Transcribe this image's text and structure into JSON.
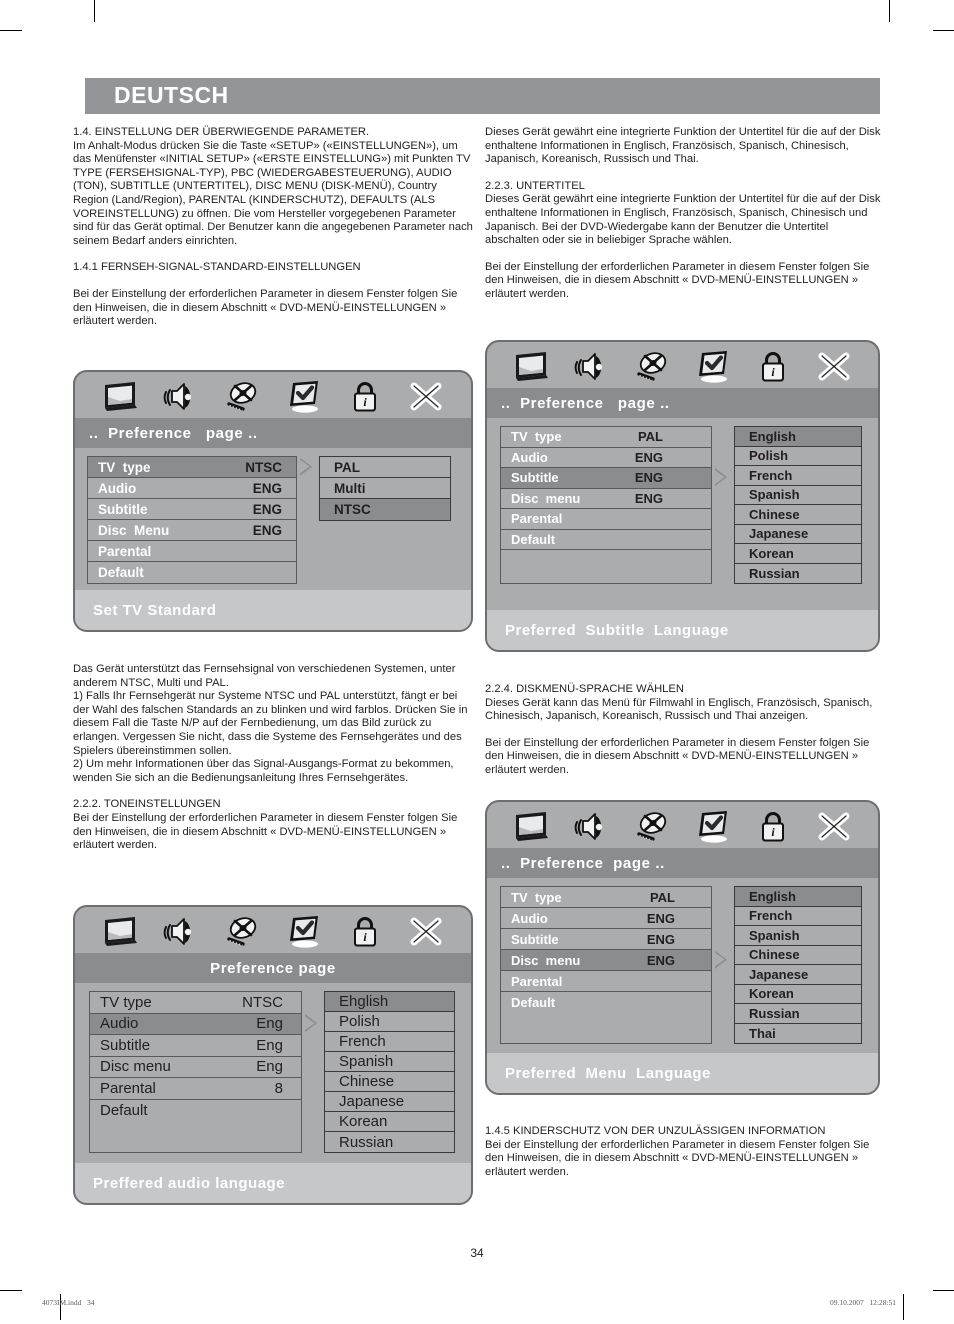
{
  "page": {
    "language_header": "DEUTSCH",
    "page_number": "34",
    "printer_file": "4073IM.indd   34",
    "printer_timestamp": "09.10.2007   12:28:51"
  },
  "colors": {
    "header_band": "#939598",
    "osd_background": "#aaacae",
    "osd_titlebar": "#8a8c8e",
    "osd_highlight": "#8a8c8e",
    "osd_status_strip": "#c6c7c9",
    "osd_border": "#6d6e71",
    "text": "#231f20"
  },
  "left_column": {
    "section_1_4_heading": "1.4. EINSTELLUNG DER ÜBERWIEGENDE PARAMETER.",
    "section_1_4_body": "Im Anhalt-Modus drücken Sie die Taste «SETUP» («EINSTELLUNGEN»), um das Menüfenster «INITIAL SETUP» («ERSTE EINSTELLUNG») mit Punkten TV TYPE (FERSEHSIGNAL-TYP), PBC (WIEDERGABESTEUERUNG), AUDIO (TON), SUBTITLLE (UNTERTITEL), DISC MENU (DISK-MENÜ), Country Region (Land/Region), PARENTAL (KINDERSCHUTZ), DEFAULTS (ALS VOREINSTELLUNG) zu öffnen. Die vom Hersteller vorgegebenen Parameter sind für das Gerät optimal. Der Benutzer kann die angegebenen Parameter nach seinem Bedarf anders einrichten.",
    "section_1_4_1_heading": "1.4.1 FERNSEH-SIGNAL-STANDARD-EINSTELLUNGEN",
    "section_1_4_1_body": "Bei der Einstellung der erforderlichen Parameter in diesem Fenster folgen Sie den Hinweisen, die in diesem Abschnitt « DVD-MENÜ-EINSTELLUNGEN » erläutert werden.",
    "after_screenshot_1_p1": "Das Gerät unterstützt das Fernsehsignal von verschiedenen Systemen, unter anderem NTSC, Multi und PAL.",
    "after_screenshot_1_p2": "1)              Falls Ihr Fernsehgerät nur Systeme NTSC und PAL unterstützt,  fängt er bei der Wahl des falschen Standards an zu blinken und wird farblos.  Drücken Sie in diesem Fall die Taste N/P auf der Fernbedienung, um das Bild zurück zu erlangen. Vergessen Sie nicht, dass die Systeme des Fernsehgerätes und des Spielers übereinstimmen sollen.",
    "after_screenshot_1_p3": "2)              Um mehr Informationen über das Signal-Ausgangs-Format zu bekommen, wenden Sie sich an die Bedienungsanleitung Ihres Fernsehgerätes.",
    "section_2_2_2_heading": "2.2.2.       TONEINSTELLUNGEN",
    "section_2_2_2_body": "Bei der Einstellung der erforderlichen Parameter in diesem Fenster folgen Sie den Hinweisen, die in diesem Abschnitt « DVD-MENÜ-EINSTELLUNGEN » erläutert werden."
  },
  "right_column": {
    "intro_body": "Dieses Gerät gewährt eine integrierte Funktion der Untertitel für die auf der Disk enthaltene Informationen in Englisch, Französisch, Spanisch, Chinesisch, Japanisch, Koreanisch, Russisch und Thai.",
    "section_2_2_3_heading": "2.2.3.       UNTERTITEL",
    "section_2_2_3_body": "Dieses Gerät gewährt eine integrierte Funktion der Untertitel für die auf der Disk enthaltene Informationen in Englisch, Französisch, Spanisch, Chinesisch und Japanisch.  Bei der DVD-Wiedergabe kann der Benutzer die Untertitel abschalten oder sie in beliebiger Sprache wählen.",
    "section_2_2_3_note": "Bei der Einstellung der erforderlichen Parameter in diesem Fenster folgen Sie den Hinweisen, die in diesem Abschnitt « DVD-MENÜ-EINSTELLUNGEN » erläutert werden.",
    "section_2_2_4_heading": "2.2.4.       DISKMENÜ-SPRACHE WÄHLEN",
    "section_2_2_4_body": "Dieses Gerät kann das Menü für Filmwahl in Englisch, Französisch, Spanisch, Chinesisch, Japanisch, Koreanisch, Russisch und Thai anzeigen.",
    "section_2_2_4_note": "Bei der Einstellung der erforderlichen Parameter in diesem Fenster folgen Sie den Hinweisen, die in diesem Abschnitt « DVD-MENÜ-EINSTELLUNGEN » erläutert werden.",
    "section_1_4_5_heading": "1.4.5 KINDERSCHUTZ VON DER UNZULÄSSIGEN INFORMATION",
    "section_1_4_5_body": "Bei der Einstellung der erforderlichen Parameter in diesem Fenster folgen Sie den Hinweisen, die in diesem Abschnitt « DVD-MENÜ-EINSTELLUNGEN » erläutert werden."
  },
  "osd_icons": [
    {
      "name": "tv-icon",
      "label": "TV"
    },
    {
      "name": "speaker-icon",
      "label": "Audio"
    },
    {
      "name": "disc-icon",
      "label": "Video/Disc"
    },
    {
      "name": "preference-check-icon",
      "label": "Preference"
    },
    {
      "name": "padlock-icon",
      "label": "Parental Lock"
    },
    {
      "name": "close-x-icon",
      "label": "Exit"
    }
  ],
  "screenshots": {
    "set_tv_standard": {
      "title": "..  Preference   page ..",
      "status": "Set TV Standard",
      "settings": [
        {
          "label": "TV  type",
          "value": "NTSC",
          "selected": true
        },
        {
          "label": "Audio",
          "value": "ENG",
          "selected": false
        },
        {
          "label": "Subtitle",
          "value": "ENG",
          "selected": false
        },
        {
          "label": "Disc  Menu",
          "value": "ENG",
          "selected": false
        },
        {
          "label": "Parental",
          "value": "",
          "selected": false
        },
        {
          "label": "Default",
          "value": "",
          "selected": false
        }
      ],
      "options": [
        {
          "label": "PAL",
          "selected": false
        },
        {
          "label": "Multi",
          "selected": false
        },
        {
          "label": "NTSC",
          "selected": true
        }
      ],
      "arrow_row_index": 0
    },
    "preferred_subtitle_language": {
      "title": "..  Preference   page ..",
      "status": "Preferred  Subtitle  Language",
      "settings": [
        {
          "label": "TV  type",
          "value": "PAL",
          "selected": false
        },
        {
          "label": "Audio",
          "value": "ENG",
          "selected": false
        },
        {
          "label": "Subtitle",
          "value": "ENG",
          "selected": true
        },
        {
          "label": "Disc  menu",
          "value": "ENG",
          "selected": false
        },
        {
          "label": "Parental",
          "value": "",
          "selected": false
        },
        {
          "label": "Default",
          "value": "",
          "selected": false
        },
        {
          "label": "",
          "value": "",
          "selected": false
        }
      ],
      "options": [
        {
          "label": "English",
          "selected": true
        },
        {
          "label": "Polish",
          "selected": false
        },
        {
          "label": "French",
          "selected": false
        },
        {
          "label": "Spanish",
          "selected": false
        },
        {
          "label": "Chinese",
          "selected": false
        },
        {
          "label": "Japanese",
          "selected": false
        },
        {
          "label": "Korean",
          "selected": false
        },
        {
          "label": "Russian",
          "selected": false
        }
      ],
      "arrow_row_index": 2
    },
    "preffered_audio_language": {
      "title": "Preference page",
      "status": "Preffered audio language",
      "settings": [
        {
          "label": "TV type",
          "value": "NTSC",
          "selected": false
        },
        {
          "label": "Audio",
          "value": "Eng",
          "selected": true
        },
        {
          "label": "Subtitle",
          "value": "Eng",
          "selected": false
        },
        {
          "label": "Disc menu",
          "value": "Eng",
          "selected": false
        },
        {
          "label": "Parental",
          "value": "8",
          "selected": false
        },
        {
          "label": "Default",
          "value": "",
          "selected": false
        }
      ],
      "options": [
        {
          "label": "Ehglish",
          "selected": true
        },
        {
          "label": "Polish",
          "selected": false
        },
        {
          "label": "French",
          "selected": false
        },
        {
          "label": "Spanish",
          "selected": false
        },
        {
          "label": "Chinese",
          "selected": false
        },
        {
          "label": "Japanese",
          "selected": false
        },
        {
          "label": "Korean",
          "selected": false
        },
        {
          "label": "Russian",
          "selected": false
        }
      ],
      "arrow_row_index": 1
    },
    "preferred_menu_language": {
      "title": "..  Preference  page ..",
      "status": "Preferred  Menu  Language",
      "settings": [
        {
          "label": "TV  type",
          "value": "PAL",
          "selected": false
        },
        {
          "label": "Audio",
          "value": "ENG",
          "selected": false
        },
        {
          "label": "Subtitle",
          "value": "ENG",
          "selected": false
        },
        {
          "label": "Disc  menu",
          "value": "ENG",
          "selected": true
        },
        {
          "label": "Parental",
          "value": "",
          "selected": false
        },
        {
          "label": "Default",
          "value": "",
          "selected": false
        }
      ],
      "options": [
        {
          "label": "English",
          "selected": true
        },
        {
          "label": "French",
          "selected": false
        },
        {
          "label": "Spanish",
          "selected": false
        },
        {
          "label": "Chinese",
          "selected": false
        },
        {
          "label": "Japanese",
          "selected": false
        },
        {
          "label": "Korean",
          "selected": false
        },
        {
          "label": "Russian",
          "selected": false
        },
        {
          "label": "Thai",
          "selected": false
        }
      ],
      "arrow_row_index": 3
    }
  }
}
